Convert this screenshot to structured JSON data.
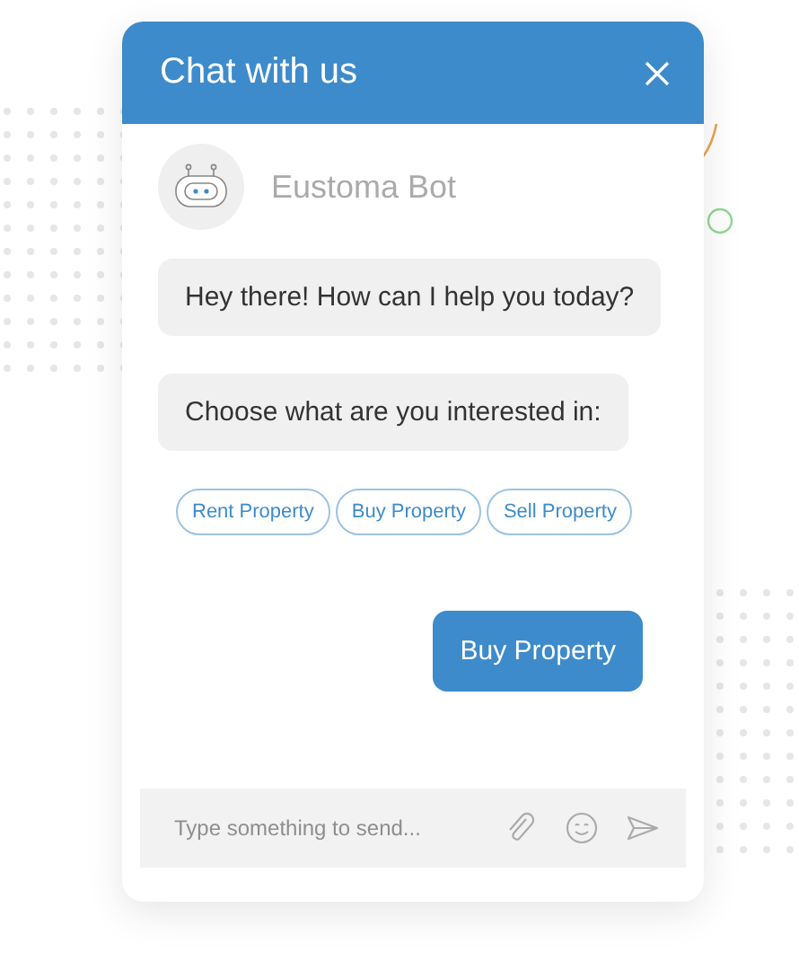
{
  "window": {
    "title": "Chat with us"
  },
  "bot": {
    "name": "Eustoma Bot"
  },
  "messages": [
    {
      "kind": "bot",
      "text": "Hey there! How can I help you today?"
    },
    {
      "kind": "bot",
      "text": "Choose what are you interested in:"
    },
    {
      "kind": "options",
      "options": [
        "Rent Property",
        "Buy Property",
        "Sell Property"
      ]
    },
    {
      "kind": "user",
      "text": "Buy Property"
    }
  ],
  "composer": {
    "placeholder": "Type something to send..."
  }
}
